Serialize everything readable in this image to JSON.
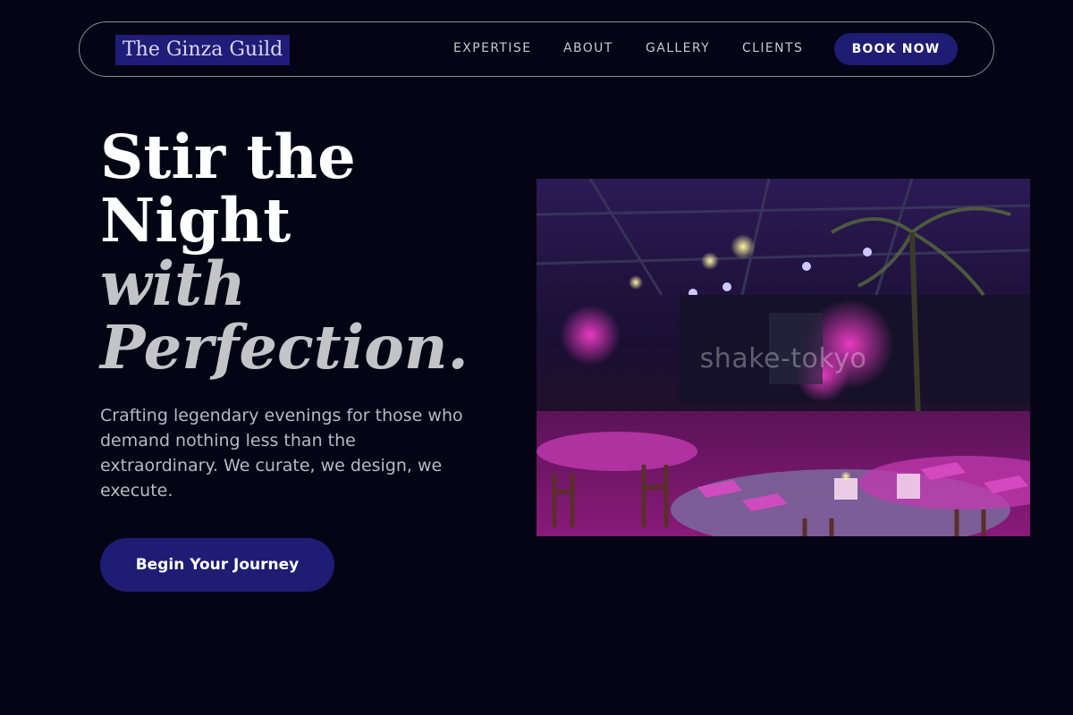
{
  "nav": {
    "logo": "The Ginza Guild",
    "links": [
      "EXPERTISE",
      "ABOUT",
      "GALLERY",
      "CLIENTS"
    ],
    "cta": "BOOK NOW"
  },
  "hero": {
    "headline": [
      "Stir the",
      "Night",
      "with",
      "Perfection."
    ],
    "subtitle": "Crafting legendary evenings for those who demand nothing less than the extraordinary. We curate, we design, we execute.",
    "cta": "Begin Your Journey"
  },
  "image": {
    "watermark": "shake-tokyo",
    "description": "banquet-hall-photo"
  },
  "colors": {
    "background": "#050414",
    "accent": "#1e1c73",
    "logo_bg": "#1f1d77",
    "text_muted": "#b9b9c4"
  }
}
